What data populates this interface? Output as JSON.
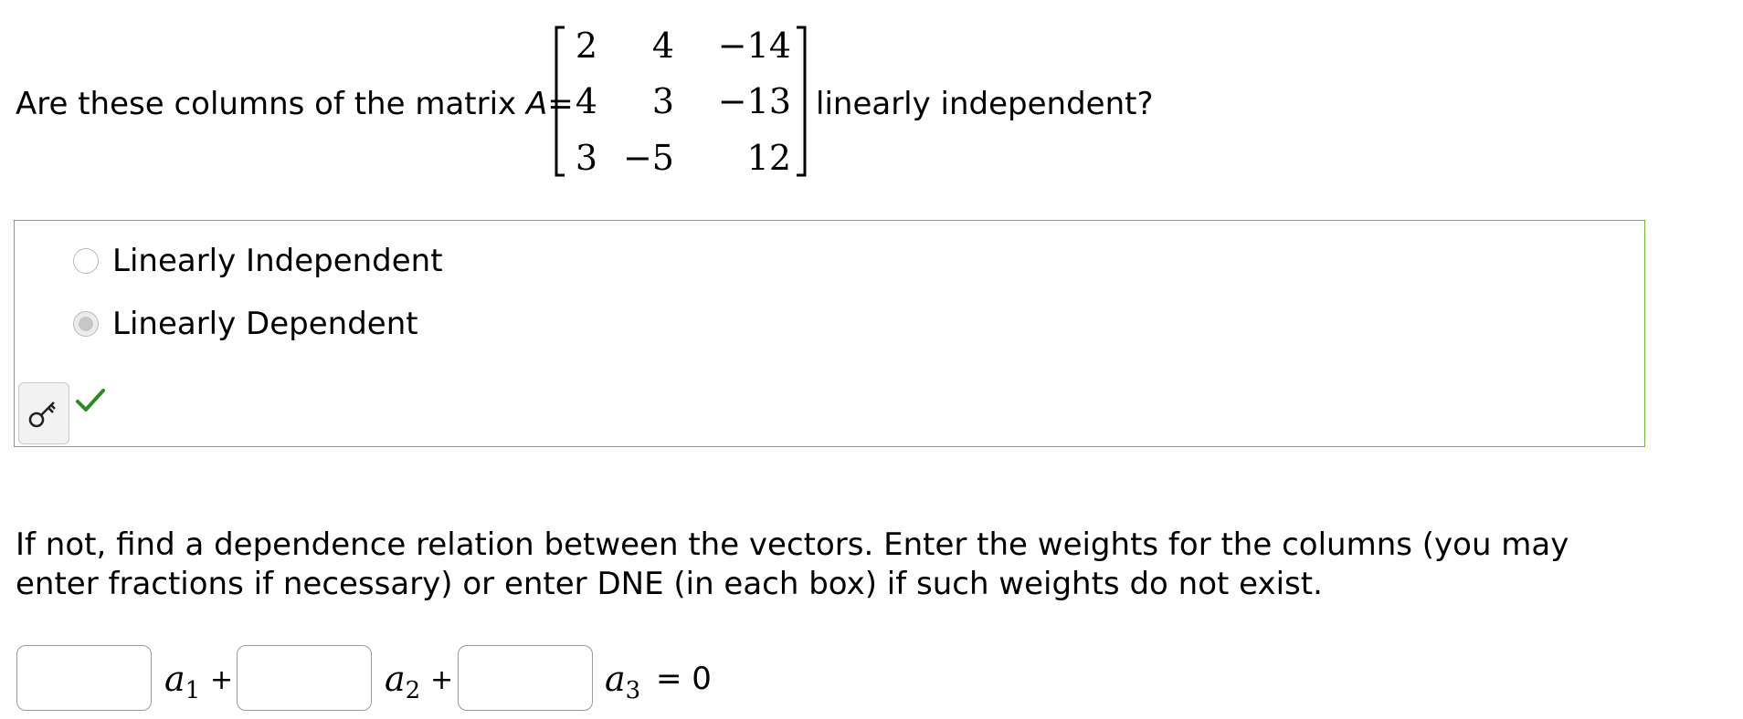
{
  "question": {
    "prefix": "Are these columns of the matrix ",
    "matrix_var": "A",
    "equals": "=",
    "suffix": "linearly independent?",
    "matrix": [
      [
        "2",
        "4",
        "−14"
      ],
      [
        "4",
        "3",
        "−13"
      ],
      [
        "3",
        "−5",
        "12"
      ]
    ]
  },
  "options": [
    {
      "label": "Linearly Independent",
      "selected": false
    },
    {
      "label": "Linearly Dependent",
      "selected": true
    }
  ],
  "feedback": {
    "key_button_icon": "key-icon",
    "status_icon": "checkmark-icon",
    "status": "correct",
    "border_color": "#6fb53f",
    "check_color": "#2e8b24"
  },
  "instructions": "If not, find a dependence relation between the vectors. Enter the weights for the columns (you may enter fractions if necessary) or enter DNE (in each box) if such weights do not exist.",
  "relation": {
    "weights": [
      "",
      "",
      ""
    ],
    "vectors": [
      {
        "base": "a",
        "sub": "1"
      },
      {
        "base": "a",
        "sub": "2"
      },
      {
        "base": "a",
        "sub": "3"
      }
    ],
    "plus": "+",
    "rhs": "= 0"
  }
}
